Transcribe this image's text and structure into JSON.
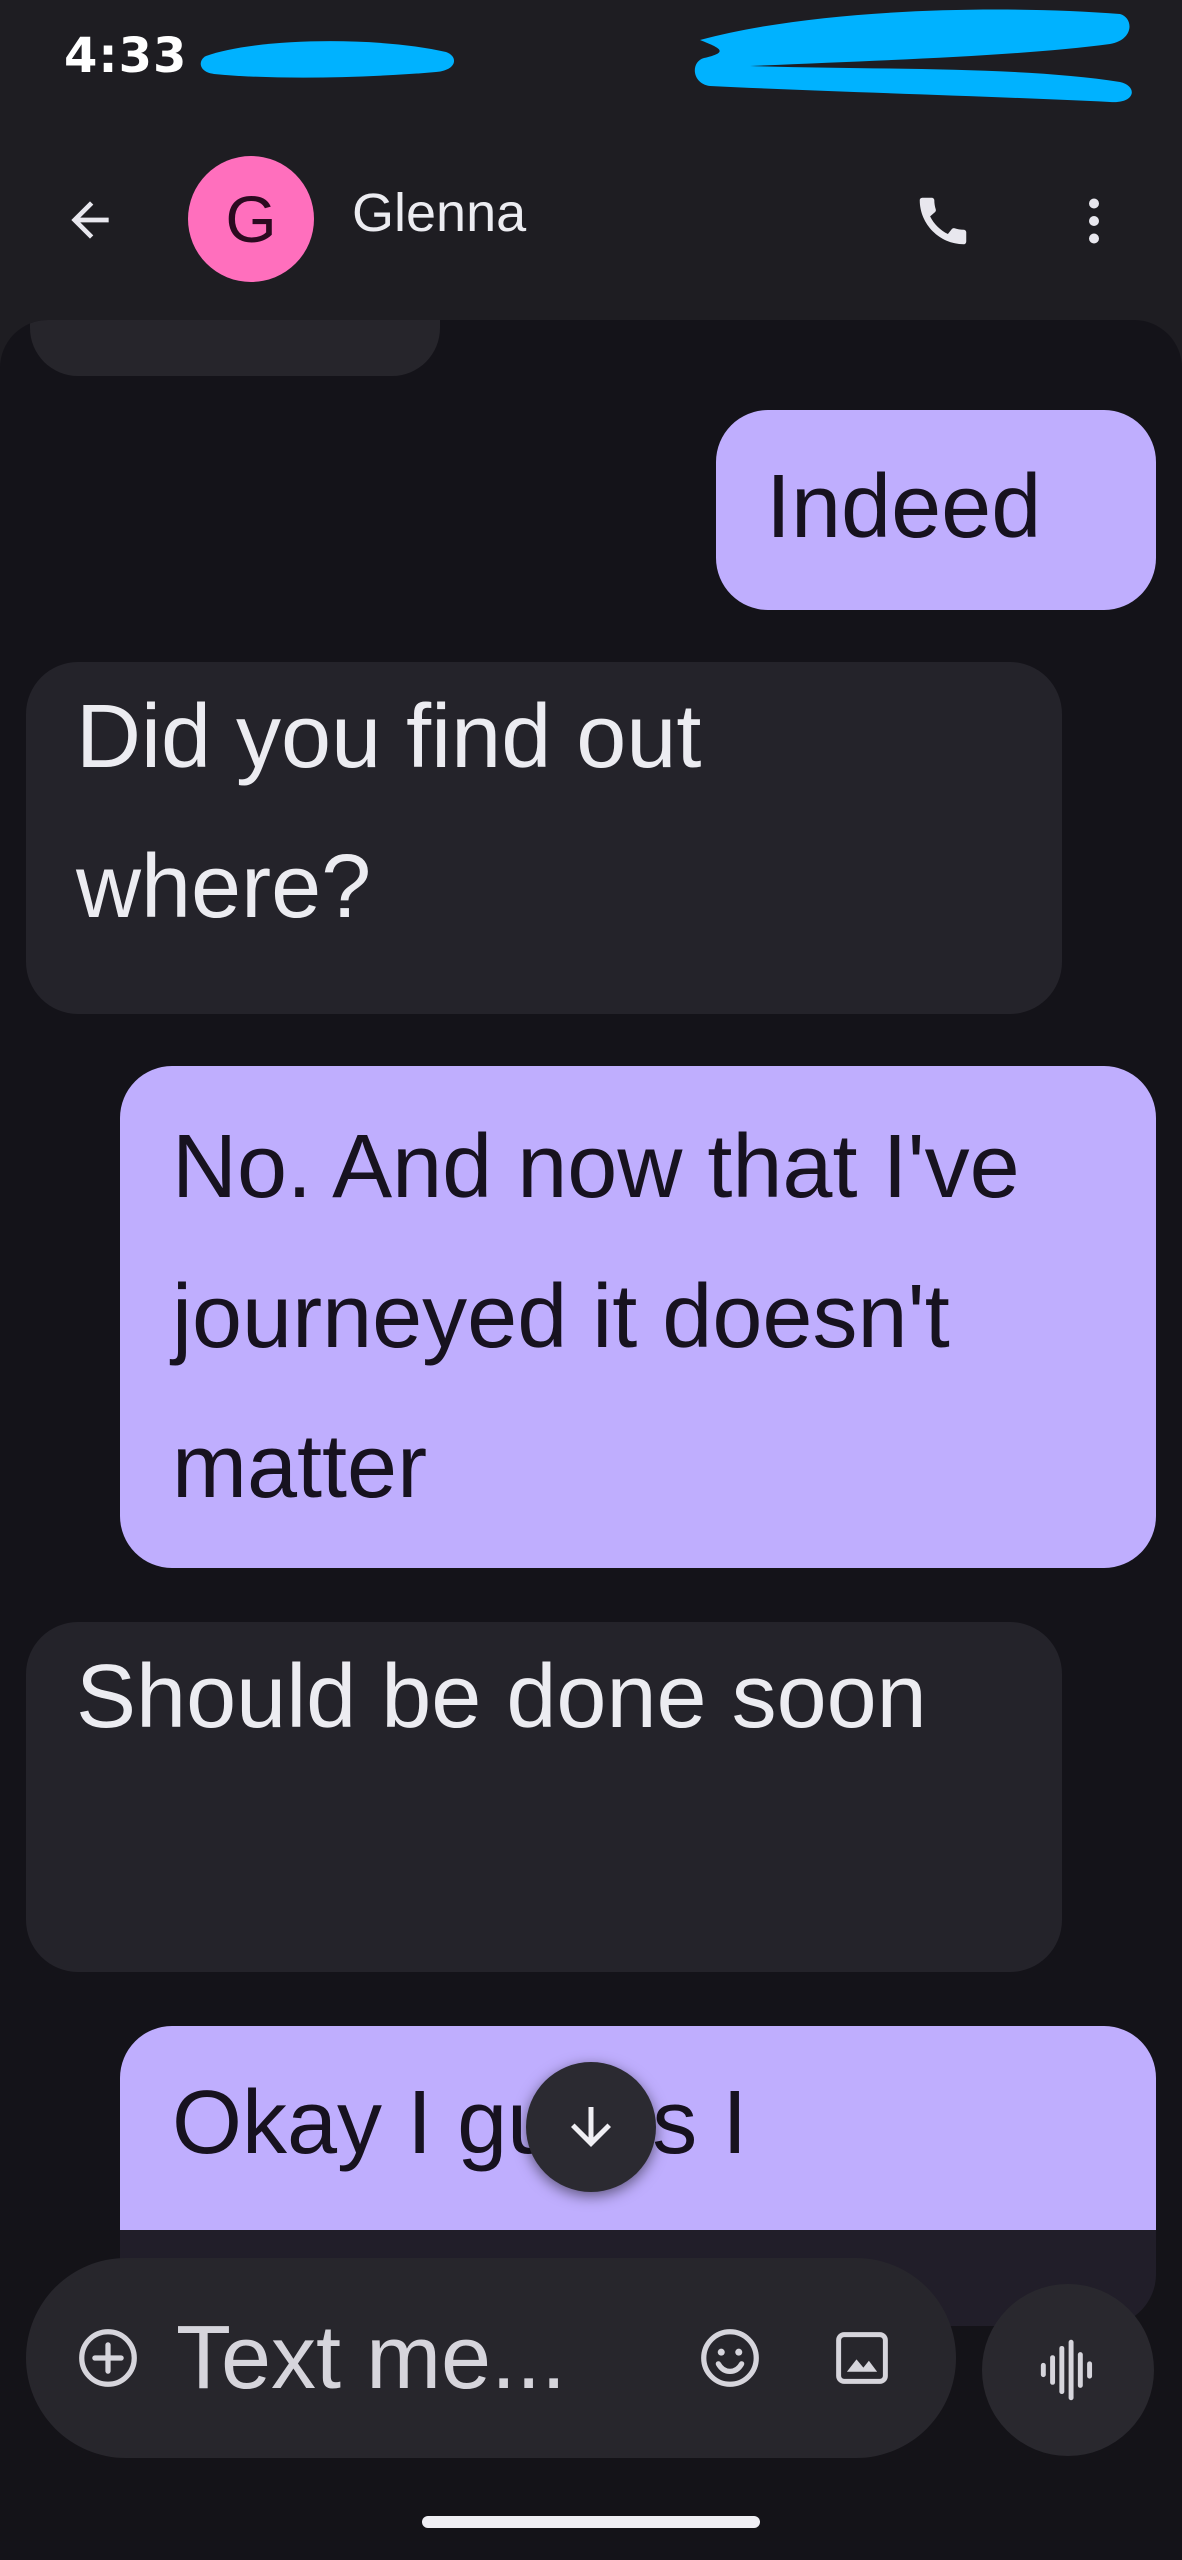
{
  "status_bar": {
    "time": "4:33",
    "redaction_color": "#00b2ff"
  },
  "app_bar": {
    "back_icon": "arrow-back-icon",
    "avatar_initial": "G",
    "avatar_color": "#ff6fbd",
    "contact_name": "Glenna",
    "call_icon": "phone-icon",
    "more_icon": "more-vert-icon"
  },
  "messages": [
    {
      "direction": "outgoing",
      "text": "Indeed"
    },
    {
      "direction": "incoming",
      "text": "Did you find out where?"
    },
    {
      "direction": "outgoing",
      "text": "No. And now that I've journeyed it doesn't matter"
    },
    {
      "direction": "incoming",
      "text": "Should be done soon"
    },
    {
      "direction": "outgoing",
      "text": "Okay I guess I"
    }
  ],
  "scroll_down_icon": "arrow-down-icon",
  "composer": {
    "add_icon": "add-circle-icon",
    "placeholder": "Text me...",
    "emoji_icon": "emoji-icon",
    "gallery_icon": "gallery-icon",
    "voice_icon": "voice-waveform-icon"
  },
  "colors": {
    "outgoing_bubble": "#bfaefe",
    "incoming_bubble": "#24232a",
    "background": "#141319"
  }
}
